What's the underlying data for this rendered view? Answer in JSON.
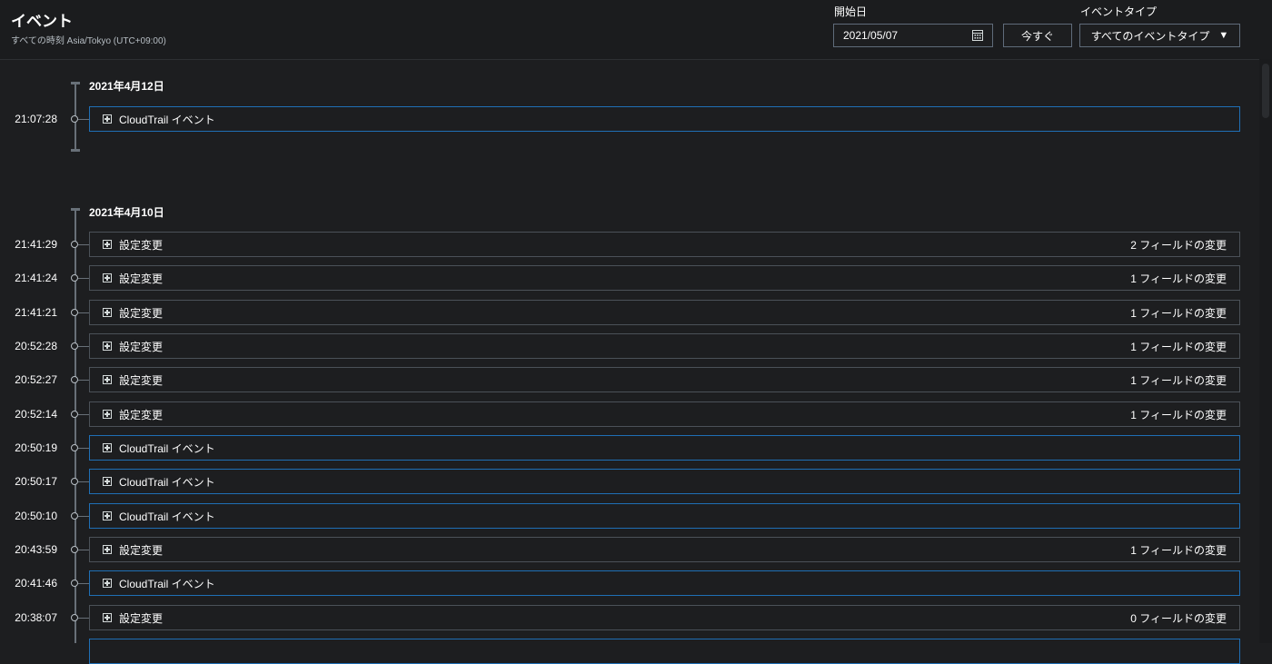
{
  "header": {
    "title": "イベント",
    "timezone_note": "すべての時刻 Asia/Tokyo (UTC+09:00)",
    "start_date_label": "開始日",
    "start_date_value": "2021/05/07",
    "now_button": "今すぐ",
    "event_type_label": "イベントタイプ",
    "event_type_value": "すべてのイベントタイプ"
  },
  "groups": [
    {
      "date": "2021年4月12日",
      "events": [
        {
          "time": "21:07:28",
          "kind": "cloudtrail",
          "label": "CloudTrail イベント",
          "changes": ""
        }
      ]
    },
    {
      "date": "2021年4月10日",
      "events": [
        {
          "time": "21:41:29",
          "kind": "config",
          "label": "設定変更",
          "changes": "2 フィールドの変更"
        },
        {
          "time": "21:41:24",
          "kind": "config",
          "label": "設定変更",
          "changes": "1 フィールドの変更"
        },
        {
          "time": "21:41:21",
          "kind": "config",
          "label": "設定変更",
          "changes": "1 フィールドの変更"
        },
        {
          "time": "20:52:28",
          "kind": "config",
          "label": "設定変更",
          "changes": "1 フィールドの変更"
        },
        {
          "time": "20:52:27",
          "kind": "config",
          "label": "設定変更",
          "changes": "1 フィールドの変更"
        },
        {
          "time": "20:52:14",
          "kind": "config",
          "label": "設定変更",
          "changes": "1 フィールドの変更"
        },
        {
          "time": "20:50:19",
          "kind": "cloudtrail",
          "label": "CloudTrail イベント",
          "changes": ""
        },
        {
          "time": "20:50:17",
          "kind": "cloudtrail",
          "label": "CloudTrail イベント",
          "changes": ""
        },
        {
          "time": "20:50:10",
          "kind": "cloudtrail",
          "label": "CloudTrail イベント",
          "changes": ""
        },
        {
          "time": "20:43:59",
          "kind": "config",
          "label": "設定変更",
          "changes": "1 フィールドの変更"
        },
        {
          "time": "20:41:46",
          "kind": "cloudtrail",
          "label": "CloudTrail イベント",
          "changes": ""
        },
        {
          "time": "20:38:07",
          "kind": "config",
          "label": "設定変更",
          "changes": "0 フィールドの変更"
        }
      ]
    }
  ],
  "colors": {
    "cloudtrail_border": "#1f6fb5",
    "config_border": "#4b5158",
    "background": "#1d1e20"
  },
  "icons": {
    "expand": "plus-square-icon",
    "calendar": "calendar-icon",
    "select": "caret-down-icon"
  }
}
